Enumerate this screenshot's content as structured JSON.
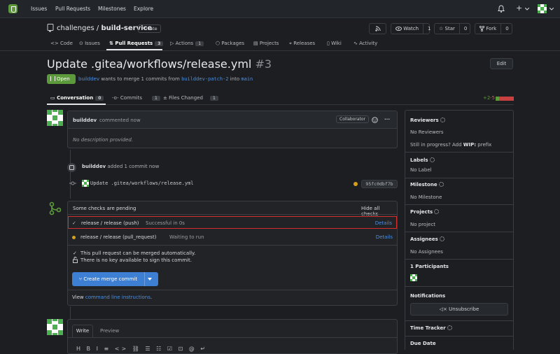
{
  "nav": {
    "items": [
      "Issues",
      "Pull Requests",
      "Milestones",
      "Explore"
    ],
    "plus": "+"
  },
  "repo": {
    "owner": "challenges",
    "name": "build-service",
    "visibility": "Private",
    "watch": {
      "label": "Watch",
      "count": "1"
    },
    "star": {
      "label": "Star",
      "count": "0"
    },
    "fork": {
      "label": "Fork",
      "count": "0"
    },
    "tabs": [
      {
        "label": "Code"
      },
      {
        "label": "Issues"
      },
      {
        "label": "Pull Requests",
        "count": "3"
      },
      {
        "label": "Actions",
        "count": "1"
      },
      {
        "label": "Packages"
      },
      {
        "label": "Projects"
      },
      {
        "label": "Releases"
      },
      {
        "label": "Wiki"
      },
      {
        "label": "Activity"
      }
    ]
  },
  "pr": {
    "title": "Update .gitea/workflows/release.yml",
    "number": "#3",
    "edit": "Edit",
    "state": "Open",
    "author": "builddev",
    "merge_text": "wants to merge 1 commits from",
    "head": "builddev-patch-2",
    "into": "into",
    "base": "main"
  },
  "subtabs": [
    {
      "label": "Conversation",
      "count": "0"
    },
    {
      "label": "Commits",
      "count": "1"
    },
    {
      "label": "Files Changed",
      "count": "1"
    }
  ],
  "diffstat": {
    "add": "+2",
    "del": "-5"
  },
  "comment": {
    "author": "builddev",
    "time": "commented now",
    "role": "Collaborator",
    "more": "···",
    "body": "No description provided."
  },
  "event": {
    "author": "builddev",
    "text": "added 1 commit now"
  },
  "commit": {
    "message": "Update .gitea/workflows/release.yml",
    "sha": "95fc0dbf7b"
  },
  "checks": {
    "header": "Some checks are pending",
    "hide": "Hide all checks",
    "items": [
      {
        "name": "release / release (push)",
        "status": "Successful in 0s",
        "details": "Details"
      },
      {
        "name": "release / release (pull_request)",
        "status": "Waiting to run",
        "details": "Details"
      }
    ],
    "merge_auto": "This pull request can be merged automatically.",
    "sign": "There is no key available to sign this commit.",
    "merge_button": "Create merge commit",
    "view": "View",
    "cli": "command line instructions",
    "period": "."
  },
  "editor": {
    "tabs": [
      "Write",
      "Preview"
    ]
  },
  "sidebar": {
    "reviewers": {
      "title": "Reviewers",
      "value": "No Reviewers",
      "wip1": "Still in progress? Add ",
      "wip2": "WIP:",
      "wip3": " prefix"
    },
    "labels": {
      "title": "Labels",
      "value": "No Label"
    },
    "milestone": {
      "title": "Milestone",
      "value": "No Milestone"
    },
    "projects": {
      "title": "Projects",
      "value": "No project"
    },
    "assignees": {
      "title": "Assignees",
      "value": "No Assignees"
    },
    "participants": {
      "title": "1 Participants"
    },
    "notifications": {
      "title": "Notifications",
      "button": "Unsubscribe"
    },
    "time": {
      "title": "Time Tracker"
    },
    "due": {
      "title": "Due Date"
    }
  }
}
